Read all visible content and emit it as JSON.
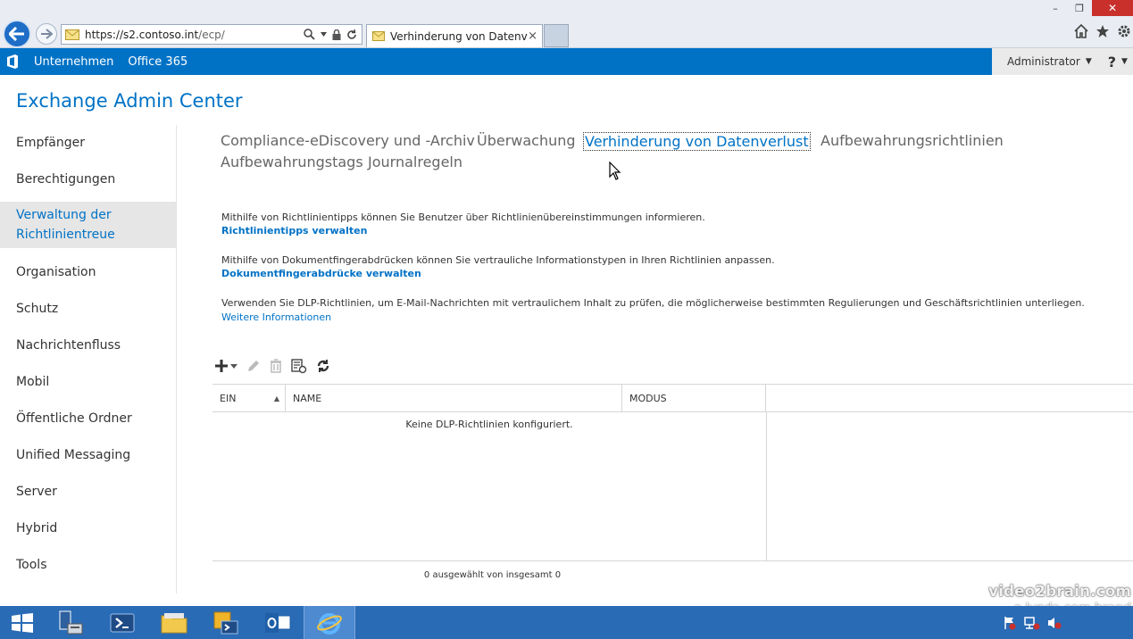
{
  "browser": {
    "url_host": "https://s2.contoso.int",
    "url_path": "/ecp/",
    "tab_title": "Verhinderung von Datenver...",
    "tab_close": "×",
    "win_min": "–",
    "win_max": "❐",
    "win_close": "✕"
  },
  "topbar": {
    "company": "Unternehmen",
    "office365": "Office 365",
    "user": "Administrator",
    "user_caret": "▼",
    "help": "?",
    "help_caret": "▼"
  },
  "app_title": "Exchange Admin Center",
  "leftnav": {
    "items": [
      {
        "label": "Empfänger"
      },
      {
        "label": "Berechtigungen"
      },
      {
        "label": "Verwaltung der Richtlinientreue"
      },
      {
        "label": "Organisation"
      },
      {
        "label": "Schutz"
      },
      {
        "label": "Nachrichtenfluss"
      },
      {
        "label": "Mobil"
      },
      {
        "label": "Öffentliche Ordner"
      },
      {
        "label": "Unified Messaging"
      },
      {
        "label": "Server"
      },
      {
        "label": "Hybrid"
      },
      {
        "label": "Tools"
      }
    ],
    "selected_line1": "Verwaltung der",
    "selected_line2": "Richtlinientreue"
  },
  "subnav": {
    "items": [
      {
        "label": "Compliance-eDiscovery und -Archiv"
      },
      {
        "label": "Überwachung"
      },
      {
        "label": "Verhinderung von Datenverlust"
      },
      {
        "label": "Aufbewahrungsrichtlinien"
      },
      {
        "label": "Aufbewahrungstags"
      },
      {
        "label": "Journalregeln"
      }
    ],
    "active_index": 2
  },
  "content": {
    "tips_text": "Mithilfe von Richtlinientipps können Sie Benutzer über Richtlinienübereinstimmungen informieren.",
    "tips_link": "Richtlinientipps verwalten",
    "fingerprint_text": "Mithilfe von Dokumentfingerabdrücken können Sie vertrauliche Informationstypen in Ihren Richtlinien anpassen.",
    "fingerprint_link": "Dokumentfingerabdrücke verwalten",
    "dlp_text": "Verwenden Sie DLP-Richtlinien, um E-Mail-Nachrichten mit vertraulichem Inhalt zu prüfen, die möglicherweise bestimmten Regulierungen und Geschäftsrichtlinien unterliegen.",
    "dlp_more": "Weitere Informationen"
  },
  "toolbar": {
    "icons": [
      "add-icon",
      "edit-icon",
      "delete-icon",
      "policy-icon",
      "refresh-icon"
    ]
  },
  "table": {
    "columns": [
      "EIN",
      "NAME",
      "MODUS"
    ],
    "sort_arrow": "▲",
    "empty_message": "Keine DLP-Richtlinien konfiguriert.",
    "status": "0 ausgewählt von insgesamt 0"
  },
  "watermark": {
    "line1": "video2brain.com",
    "line2": "a lynda.com brand"
  },
  "colors": {
    "accent": "#0072c6",
    "taskbar": "#2a6bb5"
  }
}
